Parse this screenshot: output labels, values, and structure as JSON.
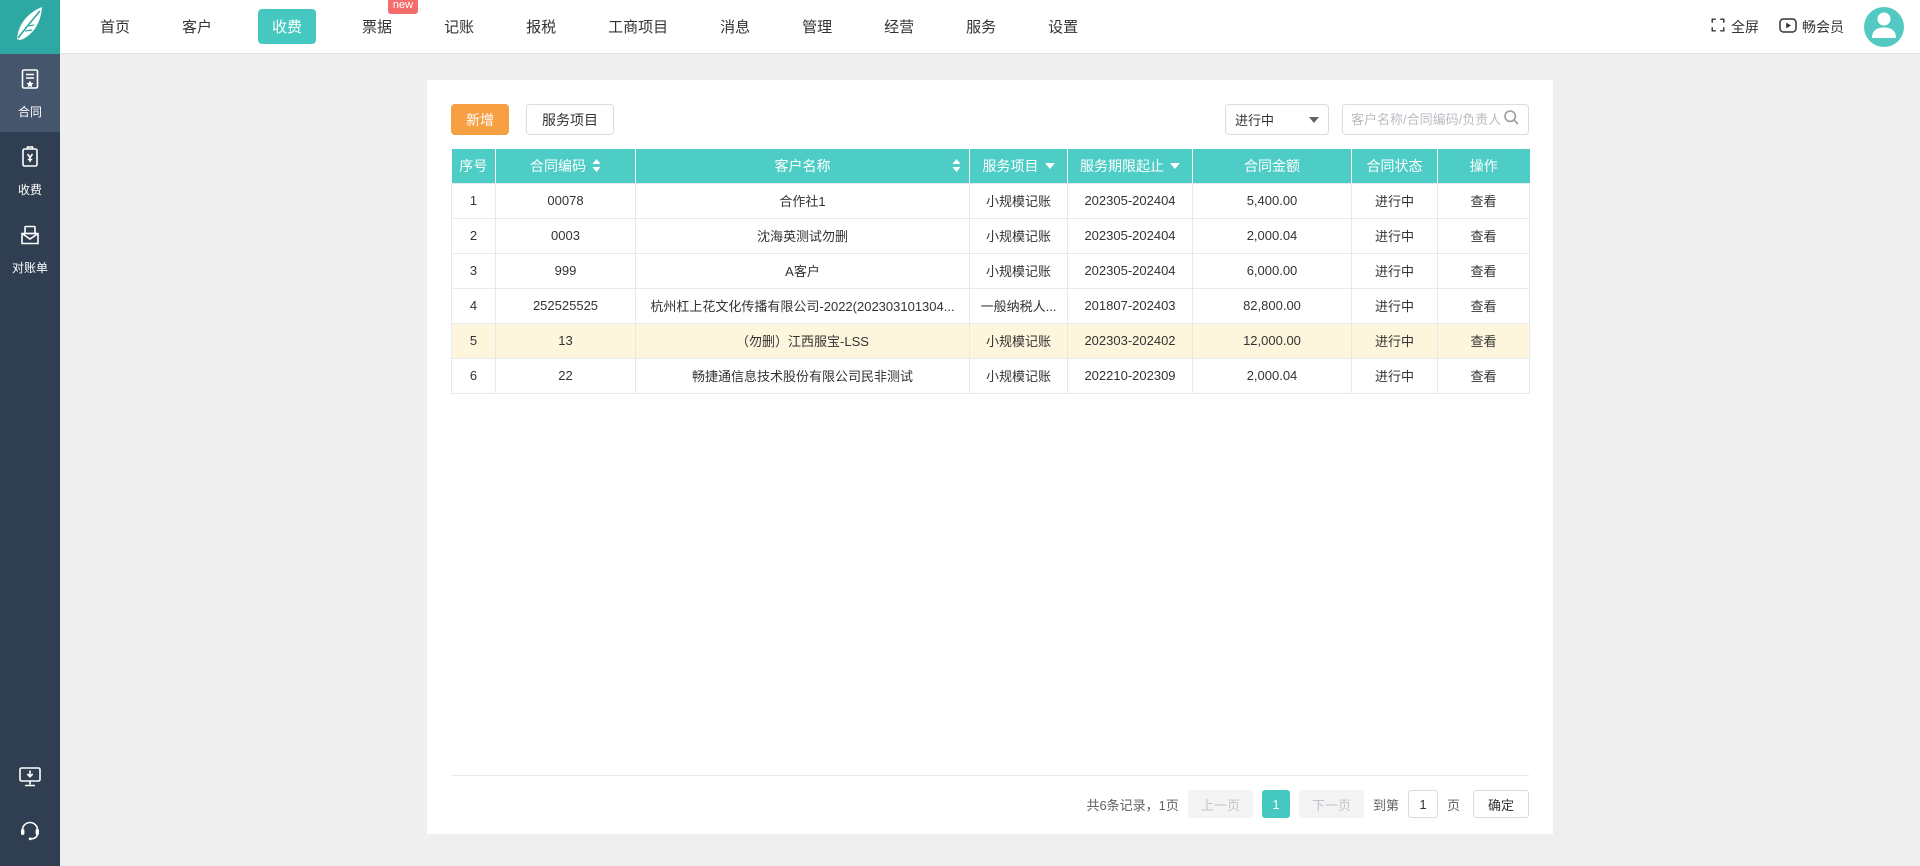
{
  "nav": {
    "items": [
      {
        "label": "首页",
        "active": false
      },
      {
        "label": "客户",
        "active": false
      },
      {
        "label": "收费",
        "active": true
      },
      {
        "label": "票据",
        "active": false,
        "badge": "new"
      },
      {
        "label": "记账",
        "active": false
      },
      {
        "label": "报税",
        "active": false
      },
      {
        "label": "工商项目",
        "active": false
      },
      {
        "label": "消息",
        "active": false
      },
      {
        "label": "管理",
        "active": false
      },
      {
        "label": "经营",
        "active": false
      },
      {
        "label": "服务",
        "active": false
      },
      {
        "label": "设置",
        "active": false
      }
    ],
    "fullscreen_label": "全屏",
    "member_label": "畅会员"
  },
  "sidebar": {
    "items": [
      {
        "label": "合同",
        "active": true
      },
      {
        "label": "收费",
        "active": false
      },
      {
        "label": "对账单",
        "active": false
      }
    ]
  },
  "toolbar": {
    "add_label": "新增",
    "service_items_label": "服务项目",
    "status_filter_value": "进行中",
    "search_placeholder": "客户名称/合同编码/负责人"
  },
  "table": {
    "headers": [
      "序号",
      "合同编码",
      "客户名称",
      "服务项目",
      "服务期限起止",
      "合同金额",
      "合同状态",
      "操作"
    ],
    "rows": [
      {
        "num": "1",
        "code": "00078",
        "customer": "合作社1",
        "service": "小规模记账",
        "period": "202305-202404",
        "amount": "5,400.00",
        "status": "进行中",
        "action": "查看"
      },
      {
        "num": "2",
        "code": "0003",
        "customer": "沈海英测试勿删",
        "service": "小规模记账",
        "period": "202305-202404",
        "amount": "2,000.04",
        "status": "进行中",
        "action": "查看"
      },
      {
        "num": "3",
        "code": "999",
        "customer": "A客户",
        "service": "小规模记账",
        "period": "202305-202404",
        "amount": "6,000.00",
        "status": "进行中",
        "action": "查看"
      },
      {
        "num": "4",
        "code": "252525525",
        "customer": "杭州杠上花文化传播有限公司-2022(202303101304...",
        "service": "一般纳税人...",
        "period": "201807-202403",
        "amount": "82,800.00",
        "status": "进行中",
        "action": "查看"
      },
      {
        "num": "5",
        "code": "13",
        "customer": "（勿删）江西服宝-LSS",
        "service": "小规模记账",
        "period": "202303-202402",
        "amount": "12,000.00",
        "status": "进行中",
        "action": "查看",
        "highlighted": true
      },
      {
        "num": "6",
        "code": "22",
        "customer": "畅捷通信息技术股份有限公司民非测试",
        "service": "小规模记账",
        "period": "202210-202309",
        "amount": "2,000.04",
        "status": "进行中",
        "action": "查看"
      }
    ]
  },
  "pagination": {
    "summary": "共6条记录，1页",
    "prev_label": "上一页",
    "current_page": "1",
    "next_label": "下一页",
    "goto_prefix": "到第",
    "goto_value": "1",
    "goto_suffix": "页",
    "confirm_label": "确定"
  },
  "colors": {
    "logo_teal": "#2ea8a2",
    "accent_teal": "#45c8bf",
    "table_header_teal": "#4ecdc6",
    "primary_orange": "#f7a043",
    "badge_red": "#f56c6c",
    "sidebar_navy": "#2f3e50",
    "sidebar_active": "#45566c",
    "row_highlight": "#fdf5dc",
    "page_background": "#efefef"
  }
}
